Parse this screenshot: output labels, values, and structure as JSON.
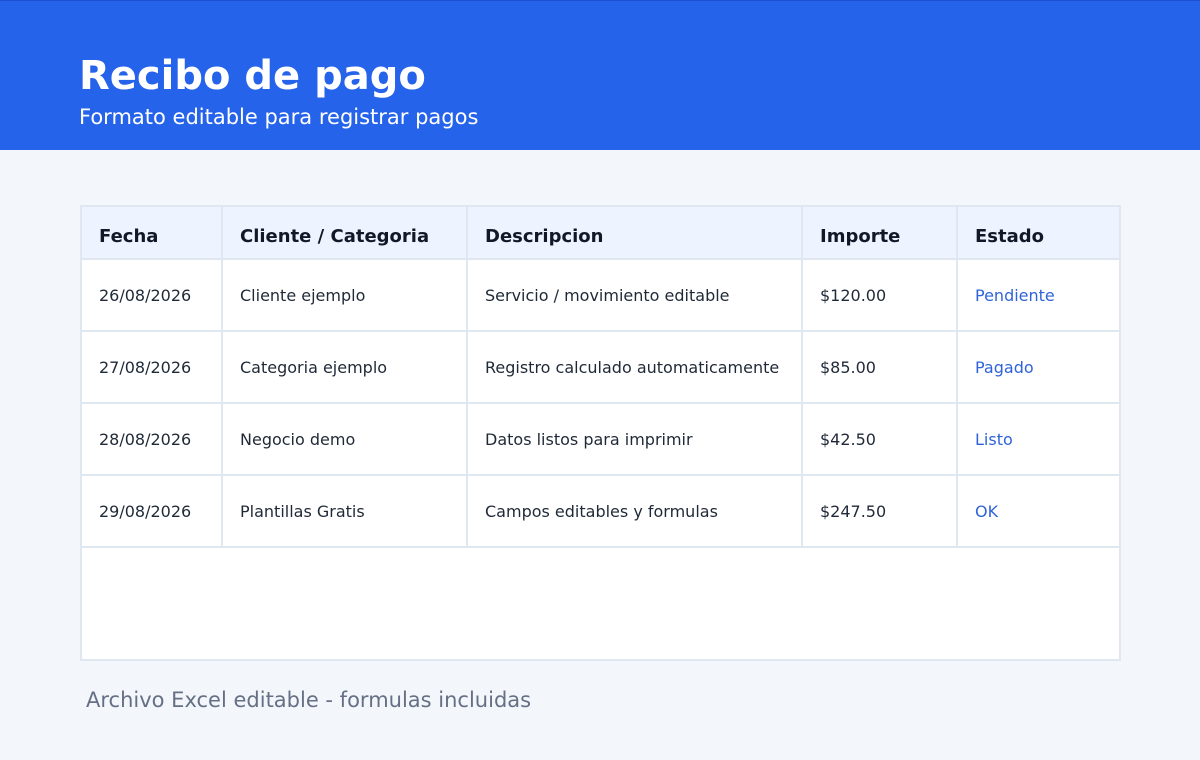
{
  "header": {
    "title": "Recibo de pago",
    "subtitle": "Formato editable para registrar pagos",
    "bg_color": "#2563eb"
  },
  "table": {
    "columns": [
      "Fecha",
      "Cliente / Categoria",
      "Descripcion",
      "Importe",
      "Estado"
    ],
    "rows": [
      {
        "fecha": "26/08/2026",
        "cliente": "Cliente ejemplo",
        "descripcion": "Servicio / movimiento editable",
        "importe": "$120.00",
        "estado": "Pendiente"
      },
      {
        "fecha": "27/08/2026",
        "cliente": "Categoria ejemplo",
        "descripcion": "Registro calculado automaticamente",
        "importe": "$85.00",
        "estado": "Pagado"
      },
      {
        "fecha": "28/08/2026",
        "cliente": "Negocio demo",
        "descripcion": "Datos listos para imprimir",
        "importe": "$42.50",
        "estado": "Listo"
      },
      {
        "fecha": "29/08/2026",
        "cliente": "Plantillas Gratis",
        "descripcion": "Campos editables y formulas",
        "importe": "$247.50",
        "estado": "OK"
      }
    ],
    "status_color": "#2f63d9",
    "header_bg": "#edf4ff"
  },
  "footer": {
    "text": "Archivo Excel editable - formulas incluidas"
  }
}
